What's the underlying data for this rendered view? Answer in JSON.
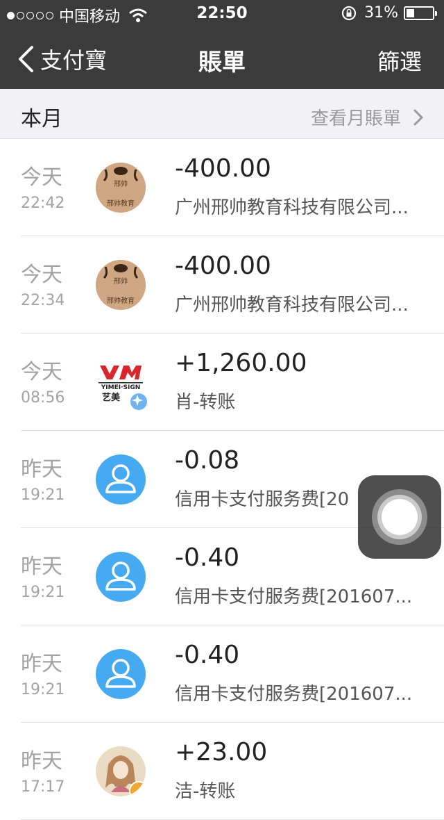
{
  "status_bar": {
    "carrier": "中国移动",
    "time": "22:50",
    "battery": "31%",
    "battery_level": 0.31
  },
  "nav": {
    "back_label": "支付寶",
    "title": "賬單",
    "filter_label": "篩選"
  },
  "month_header": {
    "label": "本月",
    "link": "查看月賬單"
  },
  "transactions": [
    {
      "day": "今天",
      "time": "22:42",
      "amount": "-400.00",
      "desc": "广州邢帅教育科技有限公司...",
      "avatar": "edu-logo"
    },
    {
      "day": "今天",
      "time": "22:34",
      "amount": "-400.00",
      "desc": "广州邢帅教育科技有限公司...",
      "avatar": "edu-logo"
    },
    {
      "day": "今天",
      "time": "08:56",
      "amount": "+1,260.00",
      "desc": "肖-转账",
      "avatar": "yimei-logo"
    },
    {
      "day": "昨天",
      "time": "19:21",
      "amount": "-0.08",
      "desc": "信用卡支付服务费[20",
      "avatar": "person-icon"
    },
    {
      "day": "昨天",
      "time": "19:21",
      "amount": "-0.40",
      "desc": "信用卡支付服务费[201607...",
      "avatar": "person-icon"
    },
    {
      "day": "昨天",
      "time": "19:21",
      "amount": "-0.40",
      "desc": "信用卡支付服务费[201607...",
      "avatar": "person-icon"
    },
    {
      "day": "昨天",
      "time": "17:17",
      "amount": "+23.00",
      "desc": "洁-转账",
      "avatar": "girl-photo"
    }
  ],
  "logos": {
    "edu_top": "邢帅",
    "edu_bottom": "邢帅教育",
    "ym_text": "YIMEI·SIGN",
    "ym_cn": "艺美"
  },
  "colors": {
    "nav_bg": "#3b3b3b",
    "person_avatar": "#45aaf2",
    "header_bg": "#f2f2f4"
  }
}
